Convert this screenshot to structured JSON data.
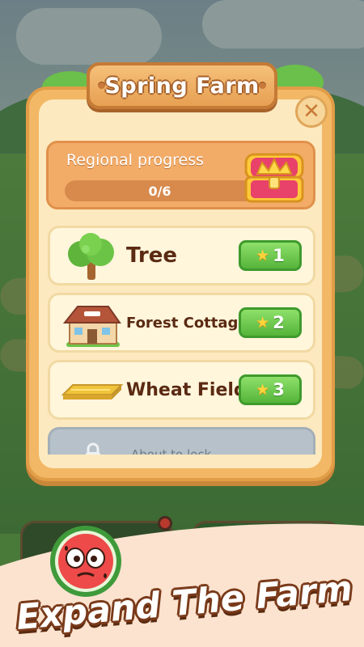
{
  "modal": {
    "title": "Spring Farm",
    "close_symbol": "✕"
  },
  "progress": {
    "label": "Regional progress",
    "value_text": "0/6",
    "fraction": 0,
    "reward_icon": "treasure-chest-icon"
  },
  "items": [
    {
      "name": "Tree",
      "icon": "tree-icon",
      "cost": "1",
      "cost_icon": "star-icon"
    },
    {
      "name": "Forest Cottage",
      "icon": "cottage-icon",
      "cost": "2",
      "cost_icon": "star-icon"
    },
    {
      "name": "Wheat Field",
      "icon": "wheat-field-icon",
      "cost": "3",
      "cost_icon": "star-icon"
    }
  ],
  "locked_item": {
    "text": "About to lock",
    "icon": "lock-icon"
  },
  "banner": {
    "text": "Expand The Farm",
    "mascot_icon": "watermelon-mascot-icon"
  },
  "colors": {
    "modal_frame": "#f3b865",
    "modal_inner": "#fde9bf",
    "button_green": "#55b43a",
    "text_brown": "#5a2a12",
    "locked_gray": "#b6c1c9"
  }
}
